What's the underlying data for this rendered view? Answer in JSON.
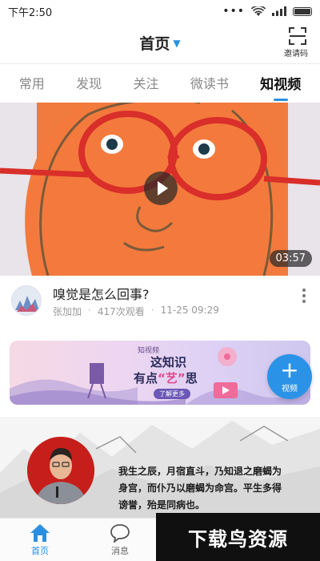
{
  "status_bar": {
    "time": "下午2:50",
    "dots": "•••"
  },
  "header": {
    "title": "首页",
    "invite_label": "邀请码"
  },
  "tabs": [
    {
      "label": "常用",
      "active": false
    },
    {
      "label": "发现",
      "active": false
    },
    {
      "label": "关注",
      "active": false
    },
    {
      "label": "微读书",
      "active": false
    },
    {
      "label": "知视频",
      "active": true
    }
  ],
  "video": {
    "duration": "03:57"
  },
  "post": {
    "title": "嗅觉是怎么回事?",
    "author": "张加加",
    "views": "417次观看",
    "date": "11-25 09:29"
  },
  "banner": {
    "brand": "知视频",
    "line1": "这知识",
    "line2_a": "有点",
    "line2_b": "“艺”",
    "line2_c": "思",
    "more": "了解更多"
  },
  "fab": {
    "plus": "+",
    "label": "视频"
  },
  "article": {
    "lines": [
      "我生之辰，月宿直斗，乃知退之磨蝎为",
      "身宫，而仆乃以磨蝎为命宫。平生多得",
      "谤誉，殆是同病也。"
    ]
  },
  "bottom_nav": {
    "home": "首页",
    "messages": "消息"
  },
  "watermark": "下载鸟资源",
  "colors": {
    "accent": "#2a8fe0",
    "video_bg": "#f17a3e",
    "fab": "#2a93e8"
  }
}
